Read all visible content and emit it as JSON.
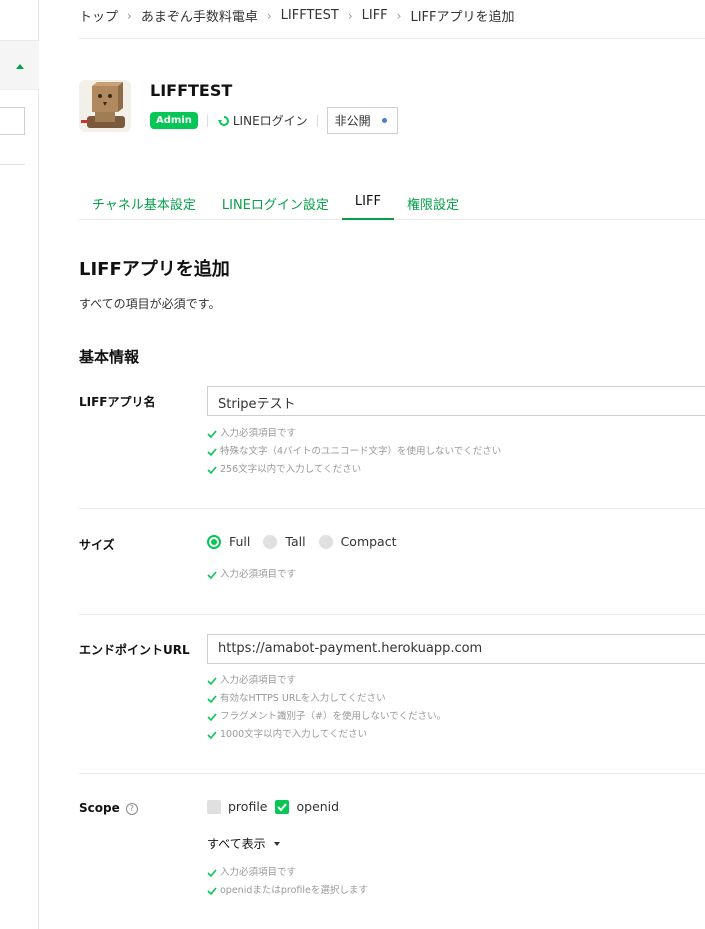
{
  "breadcrumb": [
    "トップ",
    "あまぞん手数料電卓",
    "LIFFTEST",
    "LIFF",
    "LIFFアプリを追加"
  ],
  "channel": {
    "name": "LIFFTEST",
    "role_badge": "Admin",
    "login_type": "LINEログイン",
    "status": "非公開"
  },
  "tabs": [
    "チャネル基本設定",
    "LINEログイン設定",
    "LIFF",
    "権限設定"
  ],
  "active_tab": "LIFF",
  "page": {
    "title": "LIFFアプリを追加",
    "subtitle": "すべての項目が必須です。",
    "section_title": "基本情報"
  },
  "fields": {
    "app_name": {
      "label": "LIFFアプリ名",
      "value": "Stripeテスト",
      "hints": [
        "入力必須項目です",
        "特殊な文字（4バイトのユニコード文字）を使用しないでください",
        "256文字以内で入力してください"
      ]
    },
    "size": {
      "label": "サイズ",
      "options": [
        "Full",
        "Tall",
        "Compact"
      ],
      "selected": "Full",
      "hints": [
        "入力必須項目です"
      ]
    },
    "endpoint": {
      "label": "エンドポイントURL",
      "value": "https://amabot-payment.herokuapp.com",
      "hints": [
        "入力必須項目です",
        "有効なHTTPS URLを入力してください",
        "フラグメント識別子（#）を使用しないでください。",
        "1000文字以内で入力してください"
      ]
    },
    "scope": {
      "label": "Scope",
      "options": [
        {
          "label": "profile",
          "checked": false
        },
        {
          "label": "openid",
          "checked": true
        }
      ],
      "show_all": "すべて表示",
      "hints": [
        "入力必須項目です",
        "openidまたはprofileを選択します"
      ]
    }
  },
  "colors": {
    "accent": "#06c755",
    "link": "#06a04a",
    "status_dot": "#4a7fd9"
  }
}
